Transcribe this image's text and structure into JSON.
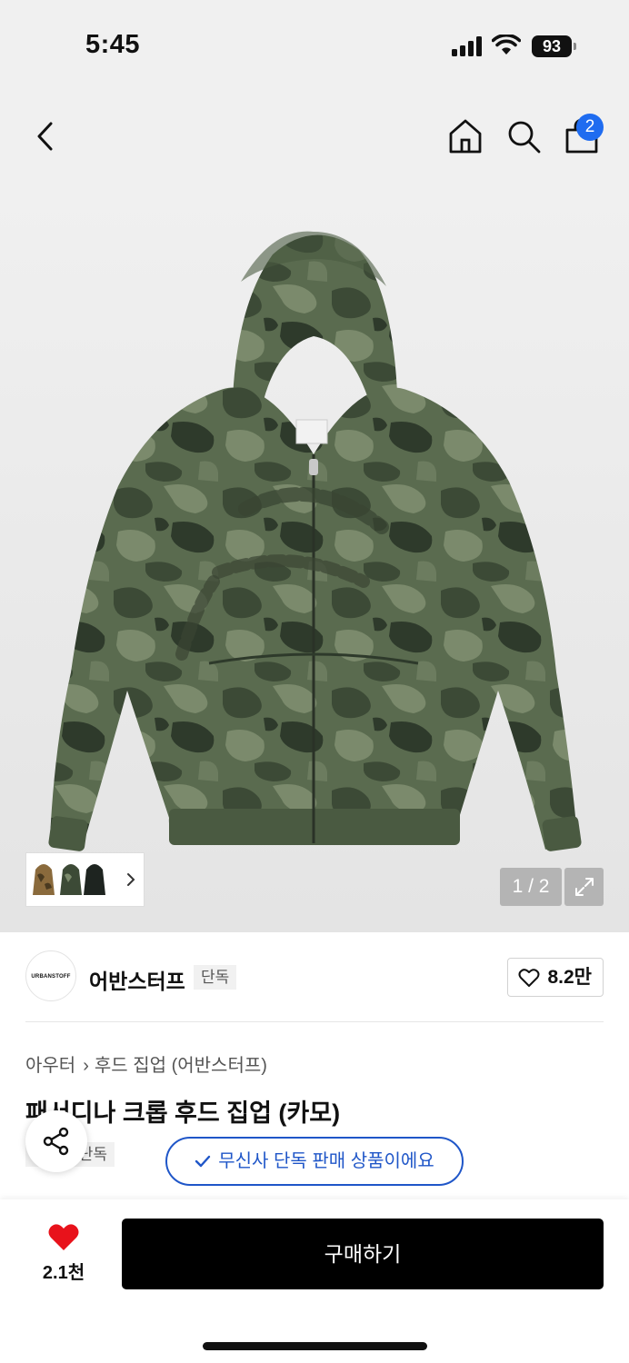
{
  "status_bar": {
    "time": "5:45",
    "battery": "93"
  },
  "nav": {
    "back_icon": "chevron-left-icon",
    "home_icon": "home-icon",
    "search_icon": "search-icon",
    "cart_icon": "shopping-bag-icon",
    "cart_badge": "2"
  },
  "gallery": {
    "counter": "1 / 2",
    "expand_icon": "expand-icon",
    "thumb_next_icon": "chevron-right-icon"
  },
  "brand": {
    "logo_text": "URBANSTOFF",
    "name": "어반스터프",
    "exclusive_tag": "단독",
    "like_count": "8.2만"
  },
  "breadcrumb": {
    "category": "아우터",
    "subcategory": "후드 집업 (어반스터프)"
  },
  "product": {
    "title": "패서디나 크롭 후드 집업 (카모)",
    "tag": "단독"
  },
  "notice": {
    "text": "무신사 단독 판매 상품이에요"
  },
  "bottom_bar": {
    "like_count": "2.1천",
    "buy_label": "구매하기"
  },
  "colors": {
    "accent_blue": "#1f56c8",
    "badge_blue": "#1f6cf0",
    "heart_red": "#e8121b",
    "camo_dark": "#3c4a36",
    "camo_mid": "#5a6b4f",
    "camo_light": "#7b8a6c"
  }
}
